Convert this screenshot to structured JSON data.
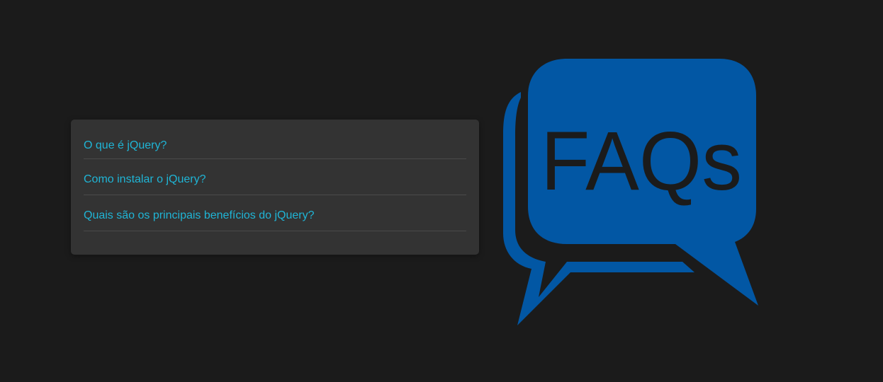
{
  "faq": {
    "questions": [
      "O que é jQuery?",
      "Como instalar o jQuery?",
      "Quais são os principais benefícios do jQuery?"
    ]
  },
  "logo": {
    "text": "FAQs",
    "icon": "speech-bubbles-icon",
    "color": "#0257a4",
    "text_color": "#1b1b1b"
  },
  "colors": {
    "background": "#1b1b1b",
    "panel": "#333333",
    "link": "#1fb5d6",
    "divider": "#4a4a4a"
  }
}
